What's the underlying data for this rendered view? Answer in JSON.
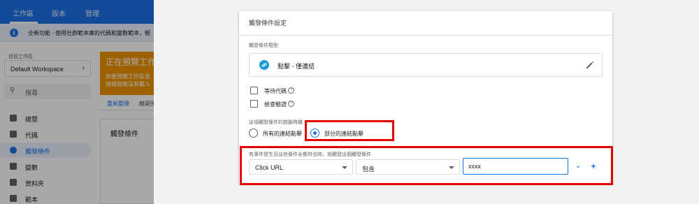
{
  "app": {
    "tabs": [
      {
        "label": "工作區"
      },
      {
        "label": "版本"
      },
      {
        "label": "管理"
      }
    ],
    "banner_text": "全新功能 - 使用社群範本庫的代碼和變數範本，輕",
    "workspace": {
      "label": "目前工作區",
      "name": "Default Workspace"
    },
    "search_text": "搜尋",
    "nav": [
      {
        "label": "總覽",
        "icon": "overview-icon"
      },
      {
        "label": "代碼",
        "icon": "tag-icon"
      },
      {
        "label": "觸發條件",
        "icon": "trigger-icon",
        "active": true
      },
      {
        "label": "變數",
        "icon": "variable-icon"
      },
      {
        "label": "資料夾",
        "icon": "folder-icon"
      },
      {
        "label": "範本",
        "icon": "template-icon"
      }
    ],
    "preview": {
      "title": "正在預覽工作",
      "line1": "如要預覽工作區並",
      "line2": "偵錯窗格沒有載入",
      "refresh": "重新整理",
      "leave": "離開預"
    },
    "trigger_card_title": "觸發條件"
  },
  "dialog": {
    "title": "觸發條件設定",
    "type_label": "觸發條件類型",
    "type_name": "點擊 - 僅連結",
    "type_icon": "link-icon",
    "edit_icon": "pencil-icon",
    "wait_tags": {
      "label": "等待代碼",
      "checked": false
    },
    "check_validation": {
      "label": "檢查驗證",
      "checked": false
    },
    "fire_label": "這項觸發條件的啟動時機",
    "fire_options": [
      {
        "label": "所有的連結點擊",
        "selected": false
      },
      {
        "label": "部分的連結點擊",
        "selected": true
      }
    ],
    "condition_label": "有事件發生且這些條件全都符合時，就觸發這個觸發條件",
    "condition": {
      "variable": "Click URL",
      "operator": "包含",
      "value": "xxxx"
    },
    "remove_label": "-",
    "add_label": "+"
  },
  "colors": {
    "accent": "#1a73e8",
    "highlight": "#e60000",
    "preview_orange": "#f09300"
  }
}
